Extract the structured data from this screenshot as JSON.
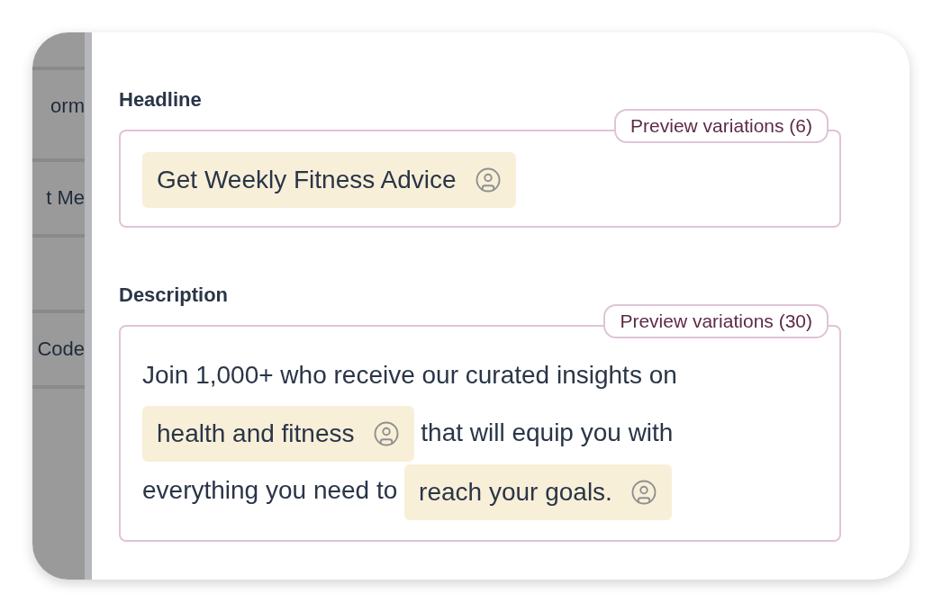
{
  "sidebar": {
    "items": [
      {
        "kind": "label",
        "label": "orm"
      },
      {
        "kind": "label",
        "label": "t Me"
      },
      {
        "kind": "blank"
      },
      {
        "kind": "label",
        "label": "Code"
      }
    ]
  },
  "fields": [
    {
      "label": "Headline",
      "preview": "Preview variations (6)",
      "content": [
        {
          "kind": "chip",
          "text": "Get Weekly Fitness Advice"
        }
      ]
    },
    {
      "label": "Description",
      "preview": "Preview variations (30)",
      "content": [
        {
          "kind": "text",
          "text": "Join 1,000+ who receive our curated insights on"
        },
        {
          "kind": "chip",
          "text": "health and fitness"
        },
        {
          "kind": "text",
          "text": "that will equip you with"
        },
        {
          "kind": "text",
          "text": "everything you need to"
        },
        {
          "kind": "chip",
          "text": "reach your goals."
        }
      ]
    }
  ]
}
